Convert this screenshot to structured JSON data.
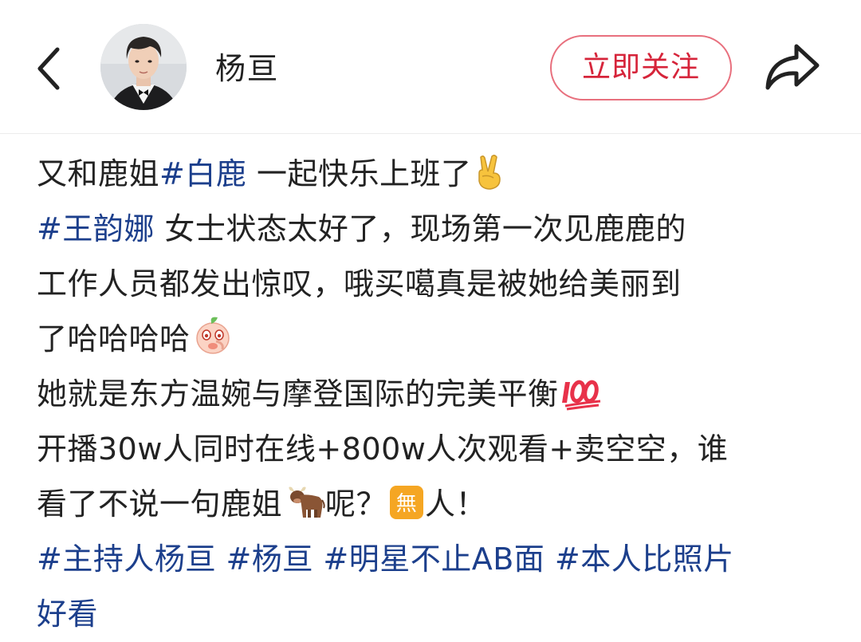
{
  "header": {
    "username": "杨亘",
    "follow_label": "立即关注"
  },
  "post": {
    "line1_text": "又和鹿姐",
    "line1_tag": "#白鹿",
    "line1_text2": " 一起快乐上班了",
    "line1_emoji": "victory-hand-emoji",
    "line2_tag": "#王韵娜",
    "line2_text": " 女士状态太好了，现场第一次见鹿鹿的",
    "line3_text": "工作人员都发出惊叹，哦买噶真是被她给美丽到",
    "line4_text": "了哈哈哈哈",
    "line4_emoji": "peach-laughing-emoji",
    "line5_text": "她就是东方温婉与摩登国际的完美平衡",
    "line5_emoji": "hundred-points-emoji",
    "line6_text": "开播30w人同时在线+800w人次观看+卖空空，谁",
    "line7_text": "看了不说一句鹿姐",
    "line7_emoji": "ox-emoji",
    "line7_text2": "呢？",
    "line7_emoji2": "none-button-emoji",
    "line7_text3": "人！",
    "tags": [
      "#主持人杨亘",
      "#杨亘",
      "#明星不止AB面",
      "#本人比照片"
    ],
    "line9_text": "好看"
  },
  "colors": {
    "accent": "#d6243a",
    "follow_border": "#e8707e",
    "hashtag": "#1c3f8c",
    "text": "#222222"
  }
}
